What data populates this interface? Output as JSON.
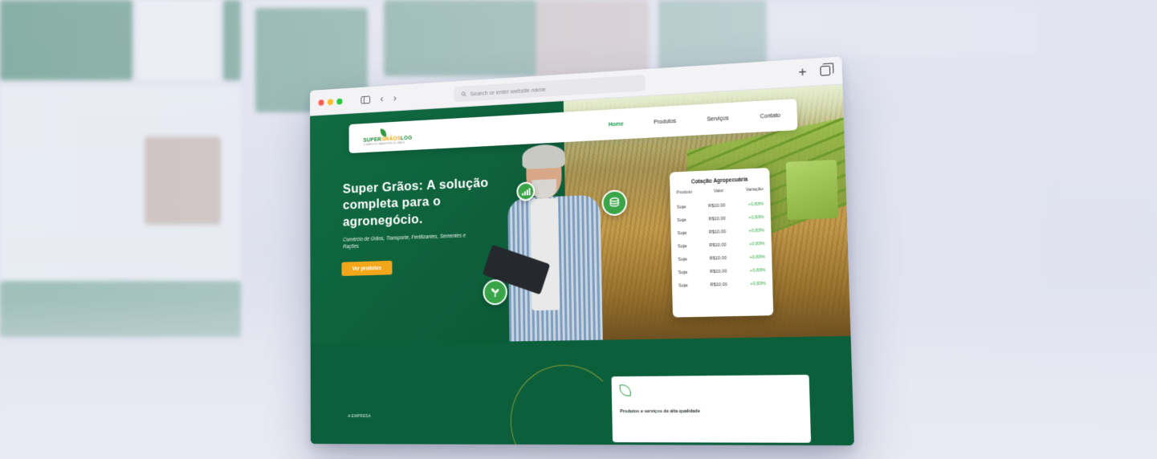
{
  "browser": {
    "address_placeholder": "Search or enter website name",
    "icons": [
      "sidebar-icon",
      "back-icon",
      "forward-icon",
      "search-icon",
      "new-tab-icon",
      "tabs-overview-icon"
    ],
    "traffic_lights": [
      "#ff5f57",
      "#febc2e",
      "#28c840"
    ]
  },
  "site": {
    "logo": {
      "name_part1": "SUPER",
      "name_part2": "GRÃOS",
      "name_part3": "LOG",
      "tagline": "COMÉRCIO E TRANSPORTE DE GRÃOS"
    },
    "nav": {
      "home": "Home",
      "produtos": "Produtos",
      "servicos": "Serviços",
      "contato": "Contato",
      "active": "Home"
    },
    "hero": {
      "title": "Super Grãos: A solução completa para o agronegócio.",
      "subtitle": "Comércio de Grãos, Transporte, Fertilizantes, Sementes e Rações",
      "cta": "Ver produtos"
    },
    "badges": [
      "signal-chart-icon",
      "coins-icon",
      "sprout-icon"
    ],
    "quote": {
      "title": "Cotação Agropecuária",
      "headers": [
        "Produto",
        "Valor",
        "Variação"
      ],
      "rows": [
        [
          "Soja",
          "R$10,00",
          "+0,83%"
        ],
        [
          "Soja",
          "R$10,00",
          "+0,83%"
        ],
        [
          "Soja",
          "R$10,00",
          "+0,83%"
        ],
        [
          "Soja",
          "R$10,00",
          "+0,83%"
        ],
        [
          "Soja",
          "R$10,00",
          "+0,83%"
        ],
        [
          "Soja",
          "R$10,00",
          "+0,83%"
        ],
        [
          "Soja",
          "R$10,00",
          "+0,83%"
        ]
      ]
    },
    "section": {
      "label": "A EMPRESA",
      "card_title": "Produtos e serviços de alta qualidade"
    }
  },
  "colors": {
    "brand_green": "#0d5e3a",
    "accent_orange": "#f2a71b",
    "positive_green": "#2eaa43"
  }
}
